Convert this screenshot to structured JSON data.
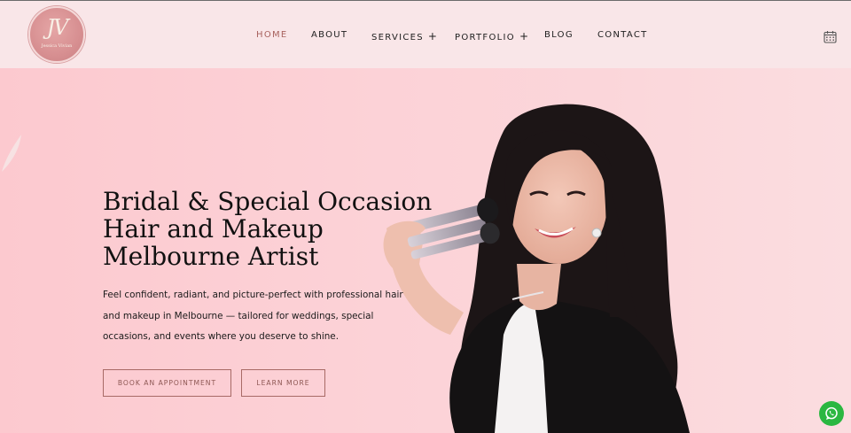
{
  "header": {
    "logo": {
      "name": "Jessica Vivian",
      "initials": "JV"
    },
    "nav": [
      {
        "label": "HOME",
        "active": true,
        "has_submenu": false
      },
      {
        "label": "ABOUT",
        "active": false,
        "has_submenu": false
      },
      {
        "label": "SERVICES",
        "active": false,
        "has_submenu": true
      },
      {
        "label": "PORTFOLIO",
        "active": false,
        "has_submenu": true
      },
      {
        "label": "BLOG",
        "active": false,
        "has_submenu": false
      },
      {
        "label": "CONTACT",
        "active": false,
        "has_submenu": false
      }
    ],
    "submenu_symbol": "+",
    "calendar_icon": "calendar-icon"
  },
  "hero": {
    "headline_lines": [
      "Bridal & Special Occasion",
      "Hair and Makeup",
      "Melbourne Artist"
    ],
    "intro_lines": [
      "Feel confident, radiant, and picture-perfect with professional hair",
      "and makeup in Melbourne — tailored for weddings, special",
      "occasions, and events where you deserve to shine."
    ],
    "buttons": {
      "book": "BOOK AN APPOINTMENT",
      "learn": "LEARN MORE"
    }
  },
  "floating": {
    "whatsapp_icon": "whatsapp-icon"
  },
  "colors": {
    "accent": "#a8625e",
    "background": "#fcd2d7",
    "header_bg": "#f9e6e8",
    "whatsapp": "#2bb741"
  }
}
